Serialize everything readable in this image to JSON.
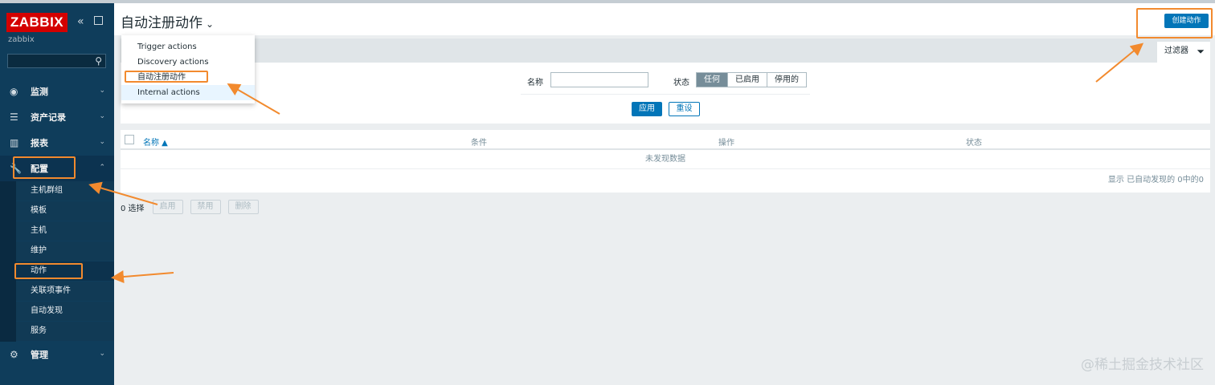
{
  "sidebar": {
    "logo_text": "ZABBIX",
    "server_name": "zabbix",
    "menu": [
      {
        "label": "监测",
        "icon": "eye-icon"
      },
      {
        "label": "资产记录",
        "icon": "list-icon"
      },
      {
        "label": "报表",
        "icon": "bar-chart-icon"
      },
      {
        "label": "配置",
        "icon": "wrench-icon"
      },
      {
        "label": "管理",
        "icon": "gear-icon"
      }
    ],
    "config_submenu": [
      "主机群组",
      "模板",
      "主机",
      "维护",
      "动作",
      "关联项事件",
      "自动发现",
      "服务"
    ]
  },
  "header": {
    "title": "自动注册动作",
    "create_button": "创建动作"
  },
  "dropdown": {
    "items": [
      "Trigger actions",
      "Discovery actions",
      "自动注册动作",
      "Internal actions"
    ]
  },
  "filter": {
    "tab_label": "过滤器",
    "name_label": "名称",
    "name_value": "",
    "status_label": "状态",
    "status_options": [
      "任何",
      "已启用",
      "停用的"
    ],
    "status_selected": "任何",
    "apply_label": "应用",
    "reset_label": "重设"
  },
  "table": {
    "columns": [
      "名称 ▲",
      "条件",
      "操作",
      "状态"
    ],
    "no_data": "未发现数据",
    "paging": "显示 已自动发现的 0中的0"
  },
  "footer_actions": {
    "selected_count": "0 选择",
    "buttons": [
      "启用",
      "禁用",
      "删除"
    ]
  },
  "watermark": "@稀土掘金技术社区",
  "colors": {
    "sidebar_bg": "#0f3d5b",
    "accent_blue": "#0275b8",
    "logo_red": "#d40000",
    "annotation_orange": "#f28a2e"
  }
}
